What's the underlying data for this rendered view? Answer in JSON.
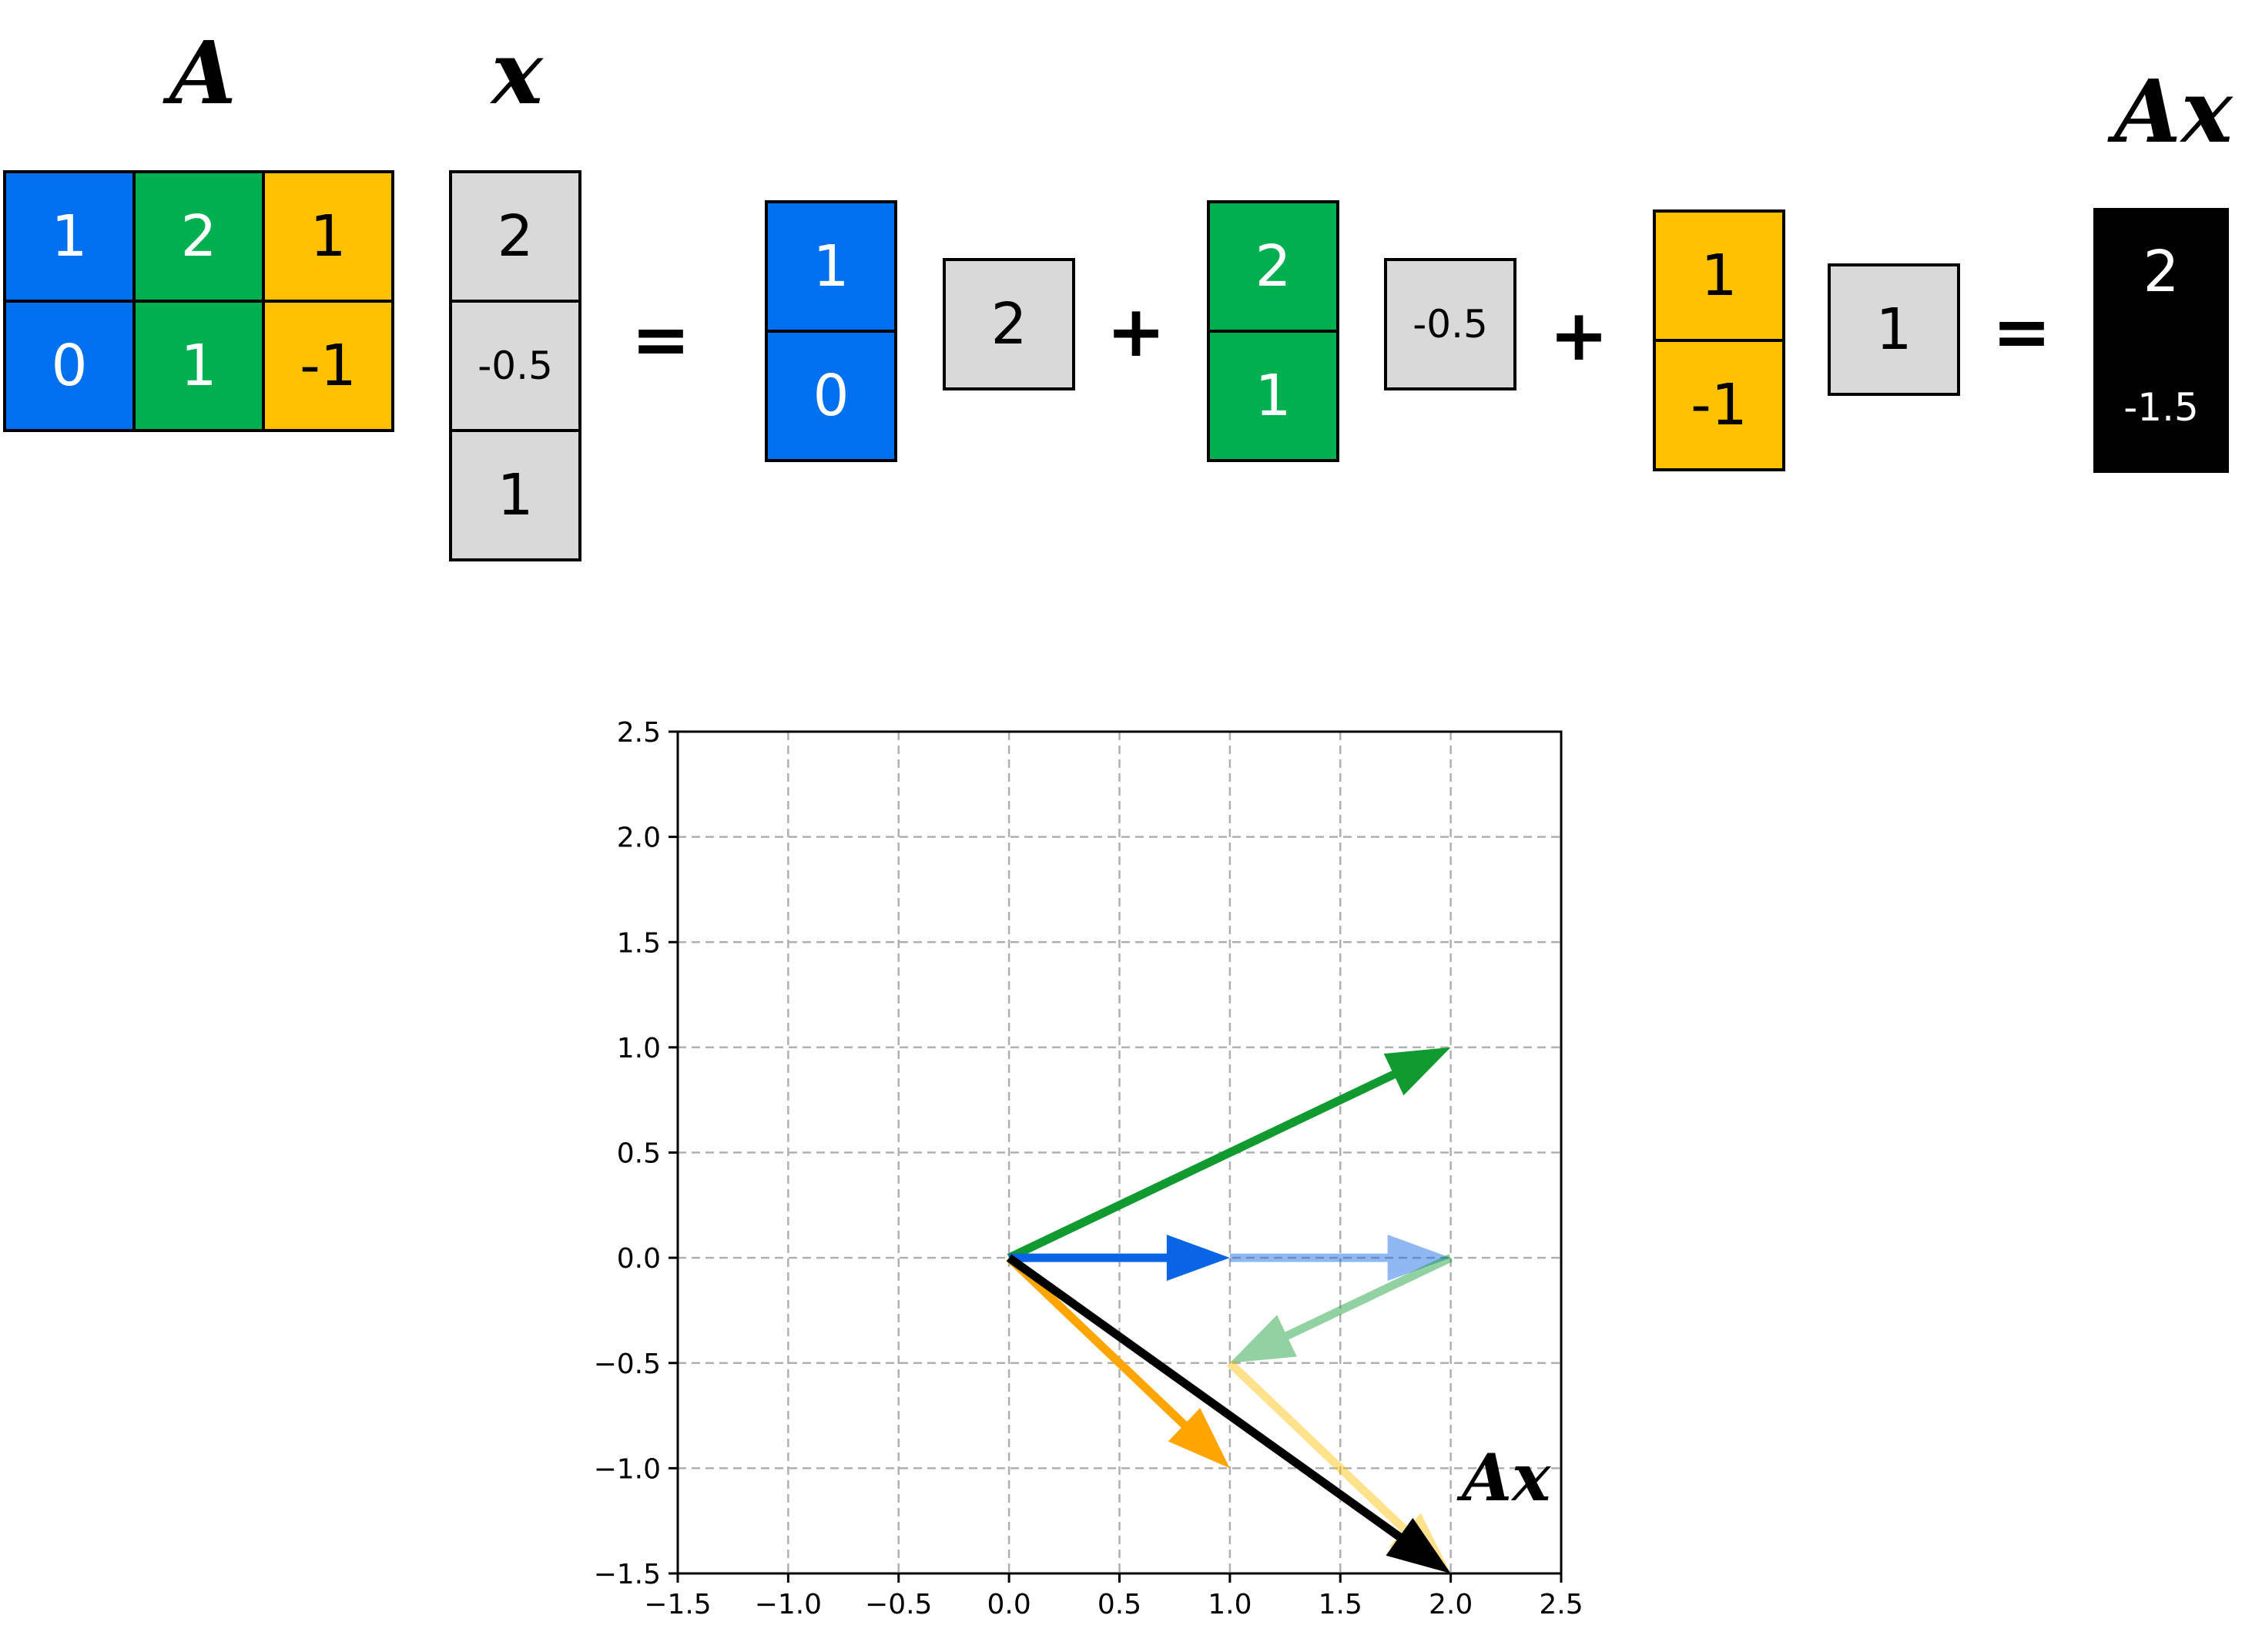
{
  "colors": {
    "blue": "#0070F0",
    "green": "#00B050",
    "yellow": "#FFC000",
    "gray": "#D9D9D9",
    "black": "#000000",
    "arrow_green": "#109A30",
    "arrow_blue": "#0A64E6",
    "arrow_blue_light": "#8CBDF2",
    "arrow_green_light": "#8CD9AA",
    "arrow_orange": "#FFA500",
    "arrow_yellow_light": "#FFE195"
  },
  "labels": {
    "A": "A",
    "x": "x",
    "Ax": "Ax"
  },
  "matrix_A": [
    [
      "1",
      "2",
      "1"
    ],
    [
      "0",
      "1",
      "-1"
    ]
  ],
  "vector_x": [
    "2",
    "-0.5",
    "1"
  ],
  "equation": {
    "eq1": "=",
    "col1": [
      "1",
      "0"
    ],
    "coef1": "2",
    "plus1": "+",
    "col2": [
      "2",
      "1"
    ],
    "coef2": "-0.5",
    "plus2": "+",
    "col3": [
      "1",
      "-1"
    ],
    "coef3": "1",
    "eq2": "=",
    "result": [
      "2",
      "-1.5"
    ]
  },
  "chart_data": {
    "type": "vector-plot",
    "xlim": [
      -1.5,
      2.5
    ],
    "ylim": [
      -1.5,
      2.5
    ],
    "xticks": [
      "−1.5",
      "−1.0",
      "−0.5",
      "0.0",
      "0.5",
      "1.0",
      "1.5",
      "2.0",
      "2.5"
    ],
    "yticks": [
      "−1.5",
      "−1.0",
      "−0.5",
      "0.0",
      "0.5",
      "1.0",
      "1.5",
      "2.0",
      "2.5"
    ],
    "grid": true,
    "vectors": [
      {
        "from": [
          0,
          0
        ],
        "to": [
          2,
          1
        ],
        "color": "#109A30",
        "opacity": 1
      },
      {
        "from": [
          0,
          0
        ],
        "to": [
          1,
          0
        ],
        "color": "#0A64E6",
        "opacity": 1
      },
      {
        "from": [
          0,
          0
        ],
        "to": [
          1,
          -1
        ],
        "color": "#FFA500",
        "opacity": 1
      },
      {
        "from": [
          1,
          0
        ],
        "to": [
          2,
          0
        ],
        "color": "#0A64E6",
        "opacity": 0.45
      },
      {
        "from": [
          2,
          0
        ],
        "to": [
          1,
          -0.5
        ],
        "color": "#109A30",
        "opacity": 0.45
      },
      {
        "from": [
          1,
          -0.5
        ],
        "to": [
          2,
          -1.5
        ],
        "color": "#FFC000",
        "opacity": 0.45
      },
      {
        "from": [
          0,
          0
        ],
        "to": [
          2,
          -1.5
        ],
        "color": "#000000",
        "opacity": 1
      }
    ],
    "annotation": "Ax"
  }
}
